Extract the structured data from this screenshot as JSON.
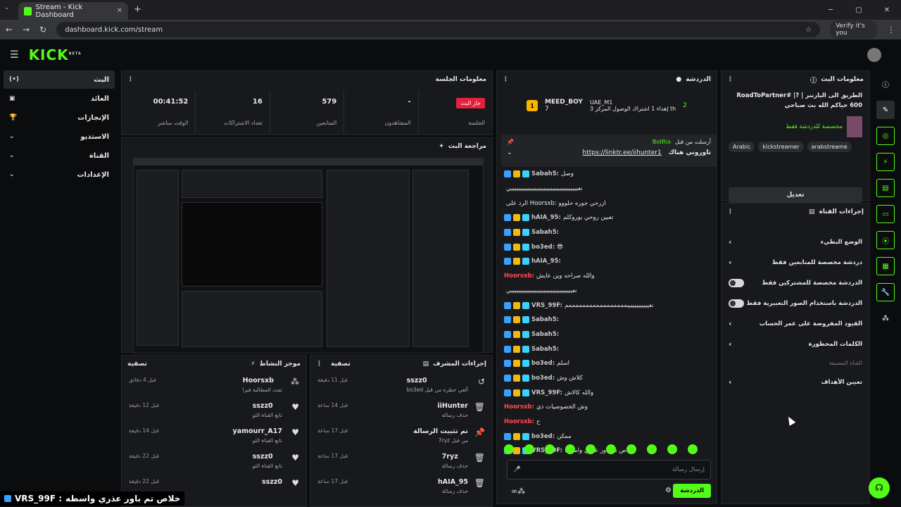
{
  "browser": {
    "tab_title": "Stream - Kick Dashboard",
    "url": "dashboard.kick.com/stream",
    "profile": "Verify it's you",
    "new_tab": "+",
    "win_min": "─",
    "win_max": "▢",
    "win_close": "✕"
  },
  "header": {
    "logo": "KICK",
    "logo_sup": "BETA"
  },
  "sidebar": {
    "items": [
      {
        "label": "البث",
        "icon": "(•)"
      },
      {
        "label": "العائد",
        "icon": "▣"
      },
      {
        "label": "الإنجازات",
        "icon": "🏆"
      },
      {
        "label": "الاستديو",
        "icon": "⌄"
      },
      {
        "label": "القناة",
        "icon": "⌄"
      },
      {
        "label": "الإعدادات",
        "icon": "⌄"
      }
    ]
  },
  "session": {
    "title": "معلومات الجلسة",
    "stats": [
      {
        "value": "",
        "label": "الجلسة",
        "badge": "جار البث"
      },
      {
        "value": "-",
        "label": "المشاهدون"
      },
      {
        "value": "579",
        "label": "المتابعين"
      },
      {
        "value": "16",
        "label": "تعداد الاشتراكات"
      },
      {
        "value": "00:41:52",
        "label": "الوقت مباشر"
      }
    ]
  },
  "preview": {
    "title": "مراجعة البث"
  },
  "activity": {
    "title": "موجز النشاط",
    "filter": "تصفية",
    "items": [
      {
        "name": "Hoorsxb",
        "sub": "تمت المطالبة فيرا",
        "time": "قبل 4 دقائق",
        "icon": "⁂"
      },
      {
        "name": "sszz0",
        "sub": "تابع القناة الثو",
        "time": "قبل 12 دقيقة",
        "icon": "♥"
      },
      {
        "name": "yamourr_A17",
        "sub": "تابع القناة الثو",
        "time": "قبل 14 دقيقة",
        "icon": "♥"
      },
      {
        "name": "sszz0",
        "sub": "تابع القناة الثو",
        "time": "قبل 22 دقيقة",
        "icon": "♥"
      },
      {
        "name": "sszz0",
        "sub": "",
        "time": "قبل 22 دقيقة",
        "icon": "♥"
      }
    ]
  },
  "mod": {
    "title": "إجراءات المشرف",
    "filter": "تصفية",
    "items": [
      {
        "name": "sszz0",
        "sub": "ألغي حظره من قبل bo3ed",
        "time": "قبل 11 دقيقة",
        "icon": "↺"
      },
      {
        "name": "iiHunter",
        "sub": "حذف رسالة",
        "time": "قبل 14 ساعة",
        "icon": "🗑"
      },
      {
        "name": "تم تثبيت الرسالة",
        "sub": "من قبل 7ryz",
        "time": "قبل 17 ساعة",
        "icon": "📌"
      },
      {
        "name": "7ryz",
        "sub": "حذف رسالة",
        "time": "قبل 17 ساعة",
        "icon": "🗑"
      },
      {
        "name": "hAIA_95",
        "sub": "حذف رسالة",
        "time": "قبل 17 ساعة",
        "icon": "🗑"
      }
    ]
  },
  "chat": {
    "title": "الدردشة",
    "top_user1": "MEED_BOY",
    "top_user1_count": "7",
    "top_user2": "UAE_M1",
    "top_user2_count": "2",
    "top_note": "إهداء 1 اشتراك الوصول المركز 3 th",
    "pinned_by": "أرسلت من قبل",
    "pinned_bot": "BotRix",
    "pinned_link": "https://linktr.ee/iihunter1",
    "pinned_text": "تاوروني هناك",
    "messages": [
      {
        "user": "Sabah5:",
        "text": "وصل",
        "color": "#c9c9c9"
      },
      {
        "user": "",
        "text": "نعيييييييييييييييييييييييييييييييييييييي",
        "color": ""
      },
      {
        "user": "",
        "text": "الرد على Hoorsxb: ازرحي جوره حلووو",
        "color": ""
      },
      {
        "user": "hAIA_95:",
        "text": "تعبين روحي بوروكلم",
        "color": "#c9c9c9"
      },
      {
        "user": "Sabah5:",
        "text": "",
        "color": "#c9c9c9"
      },
      {
        "user": "bo3ed:",
        "text": "😎",
        "color": "#c9c9c9"
      },
      {
        "user": "hAIA_95:",
        "text": "",
        "color": "#c9c9c9"
      },
      {
        "user": "Hoorsxb:",
        "text": "والله صراحه وين عايش",
        "color": "#ff4b55"
      },
      {
        "user": "",
        "text": "نعييييييييييييييييييييييييييييييييييي",
        "color": ""
      },
      {
        "user": "VRS_99F:",
        "text": "نعييييييييييييمممممممممممممممممم",
        "color": "#c9c9c9"
      },
      {
        "user": "Sabah5:",
        "text": "",
        "color": "#c9c9c9"
      },
      {
        "user": "Sabah5:",
        "text": "",
        "color": "#c9c9c9"
      },
      {
        "user": "Sabah5:",
        "text": "",
        "color": "#c9c9c9"
      },
      {
        "user": "bo3ed:",
        "text": "اسلم",
        "color": "#c9c9c9"
      },
      {
        "user": "bo3ed:",
        "text": "كلاش وش",
        "color": "#c9c9c9"
      },
      {
        "user": "VRS_99F:",
        "text": "والله كالاش",
        "color": "#c9c9c9"
      },
      {
        "user": "Hoorsxb:",
        "text": "وش الخصوصيات ذي",
        "color": "#ff4b55"
      },
      {
        "user": "Hoorsxb:",
        "text": "ح",
        "color": "#ff4b55"
      },
      {
        "user": "bo3ed:",
        "text": "ممكن",
        "color": "#c9c9c9"
      },
      {
        "user": "VRS_99F:",
        "text": "خلاص تم باور عذري واسطه",
        "color": "#c9c9c9"
      }
    ],
    "input_placeholder": "إرسال رسالة",
    "send": "الدردشة"
  },
  "stream_info": {
    "title": "معلومات البث",
    "stream_title": "الطريق الى البارتنر | RoadToPartner# |?600 حياكم الله بث صباحي",
    "category": "مخصصة للدردشة فقط",
    "tags": [
      "Arabic",
      "kickstreamer",
      "arabstreame"
    ],
    "edit": "تعديل"
  },
  "channel_actions": {
    "title": "إجراءات القناة",
    "rows": [
      {
        "label": "الوضع البطيء",
        "type": "chev"
      },
      {
        "label": "دردشة مخصصة للمتابعين فقط",
        "type": "chev"
      },
      {
        "label": "الدردشة مخصصة للمشتركين فقط",
        "type": "toggle"
      },
      {
        "label": "الدردشة باستخدام الصور التعبيرية فقط",
        "type": "toggle"
      },
      {
        "label": "القيود المفروضة على عمر الحساب",
        "type": "chev"
      },
      {
        "label": "الكلمات المحظورة",
        "type": "chev"
      }
    ],
    "section": "القناة المضيفة",
    "goals": "تعيين الأهداف"
  },
  "overlay": {
    "user": "VRS_99F :",
    "text": "خلاص تم باور عذري واسطه"
  },
  "colors": {
    "accent": "#53fc18",
    "live": "#e5203d"
  }
}
